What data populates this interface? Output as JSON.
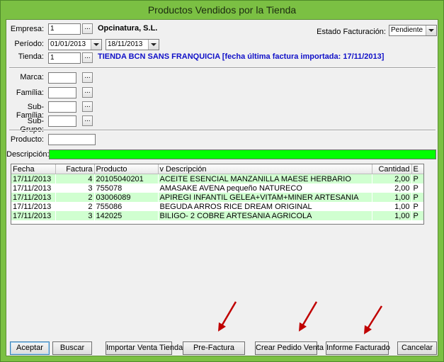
{
  "window": {
    "title": "Productos Vendidos por la Tienda"
  },
  "form": {
    "empresa": {
      "label": "Empresa:",
      "value": "1",
      "name": "Opcinatura, S.L."
    },
    "periodo": {
      "label": "Período:",
      "from": "01/01/2013",
      "to": "18/11/2013"
    },
    "tienda": {
      "label": "Tienda:",
      "value": "1",
      "name": "TIENDA BCN SANS FRANQUICIA [fecha última factura importada: 17/11/2013]"
    },
    "estado": {
      "label": "Estado Facturación:",
      "value": "Pendiente"
    },
    "marca": {
      "label": "Marca:",
      "value": ""
    },
    "familia": {
      "label": "Família:",
      "value": ""
    },
    "subfamilia": {
      "label": "Sub-Família:",
      "value": ""
    },
    "subgrupo": {
      "label": "Sub-Grupo:",
      "value": ""
    },
    "producto": {
      "label": "Producto:",
      "value": ""
    },
    "descripcion": {
      "label": "Descripción:",
      "value": ""
    },
    "dots": "..."
  },
  "table": {
    "headers": [
      "Fecha",
      "Factura",
      "Producto",
      "v Descripción",
      "Cantidad",
      "E"
    ],
    "rows": [
      [
        "17/11/2013",
        "4",
        "20105040201",
        "ACEITE ESENCIAL MANZANILLA MAESE HERBARIO",
        "2,00",
        "P"
      ],
      [
        "17/11/2013",
        "3",
        "755078",
        "AMASAKE AVENA pequeño NATURECO",
        "2,00",
        "P"
      ],
      [
        "17/11/2013",
        "2",
        "03006089",
        "APIREGI INFANTIL GELEA+VITAM+MINER ARTESANIA",
        "1,00",
        "P"
      ],
      [
        "17/11/2013",
        "2",
        "755086",
        "BEGUDA ARROS RICE DREAM ORIGINAL",
        "1,00",
        "P"
      ],
      [
        "17/11/2013",
        "3",
        "142025",
        "BILIGO- 2 COBRE ARTESANIA AGRICOLA",
        "1,00",
        "P"
      ]
    ]
  },
  "buttons": {
    "aceptar": "Aceptar",
    "buscar": "Buscar",
    "importar": "Importar Venta Tienda",
    "prefactura": "Pre-Factura",
    "crear_pedido": "Crear Pedido Venta",
    "informe": "Informe Facturado",
    "cancelar": "Cancelar"
  },
  "colors": {
    "window_frame": "#7bc043",
    "description_bar": "#00ff00",
    "row_highlight": "#d0ffd0",
    "tienda_text": "#1010c8",
    "annotation_arrow": "#c00000"
  }
}
